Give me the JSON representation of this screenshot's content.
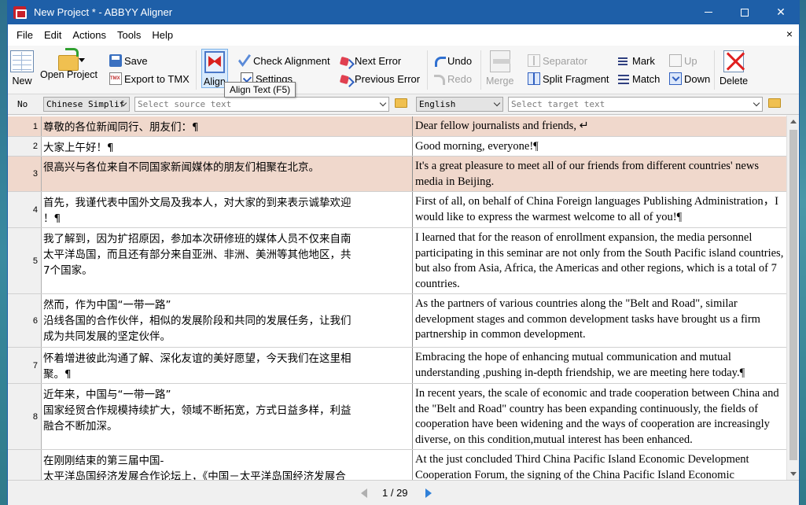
{
  "window": {
    "title": "New Project * - ABBYY Aligner",
    "close_glyph": "✕"
  },
  "menu": {
    "items": [
      "File",
      "Edit",
      "Actions",
      "Tools",
      "Help"
    ],
    "close_glyph": "×"
  },
  "toolbar": {
    "new": "New",
    "open_project": "Open Project",
    "save": "Save",
    "export_tmx": "Export to TMX",
    "align": "Align",
    "check_alignment": "Check Alignment",
    "settings": "Settings",
    "next_error": "Next Error",
    "previous_error": "Previous Error",
    "undo": "Undo",
    "redo": "Redo",
    "merge": "Merge",
    "separator": "Separator",
    "split_fragment": "Split Fragment",
    "mark": "Mark",
    "match": "Match",
    "up": "Up",
    "down": "Down",
    "delete": "Delete"
  },
  "tooltip": "Align Text (F5)",
  "langbar": {
    "no_label": "No",
    "source_language": "Chinese Simplif",
    "source_placeholder": "Select source text",
    "target_language": "English",
    "target_placeholder": "Select target text"
  },
  "rows": [
    {
      "no": "1",
      "highlight": true,
      "src": [
        "尊敬的各位新闻同行、朋友们：¶"
      ],
      "tgt": "Dear fellow journalists and friends, ↵"
    },
    {
      "no": "2",
      "highlight": false,
      "src": [
        "大家上午好！¶"
      ],
      "tgt": "Good morning, everyone!¶"
    },
    {
      "no": "3",
      "highlight": true,
      "src": [
        "很高兴与各位来自不同国家新闻媒体的朋友们相聚在北京。"
      ],
      "tgt": "It's a great pleasure to meet all of our friends from different countries' news media in Beijing."
    },
    {
      "no": "4",
      "highlight": false,
      "src": [
        "首先，我谨代表中国外文局及我本人，对大家的到来表示诚挚欢迎",
        "！¶"
      ],
      "tgt": "First of all, on behalf of China Foreign languages Publishing Administration，I would like to express the warmest welcome to all of you!¶"
    },
    {
      "no": "5",
      "highlight": false,
      "src": [
        "我了解到，因为扩招原因，参加本次研修班的媒体人员不仅来自南",
        "太平洋岛国，而且还有部分来自亚洲、非洲、美洲等其他地区，共",
        "7个国家。"
      ],
      "tgt": "I learned that for the reason of enrollment expansion, the media personnel participating in this seminar are not only from the South Pacific island countries, but also from Asia, Africa, the Americas and other regions, which is a total of 7 countries."
    },
    {
      "no": "6",
      "highlight": false,
      "src": [
        "然而，作为中国“一带一路”",
        "沿线各国的合作伙伴，相似的发展阶段和共同的发展任务，让我们",
        "成为共同发展的坚定伙伴。"
      ],
      "tgt": "As the partners of various countries along the \"Belt and Road\", similar development stages and common development tasks have brought us a firm partnership in common development."
    },
    {
      "no": "7",
      "highlight": false,
      "src": [
        "怀着增进彼此沟通了解、深化友谊的美好愿望，今天我们在这里相",
        "聚。¶"
      ],
      "tgt": "Embracing the hope of enhancing mutual communication and mutual understanding ,pushing in-depth friendship, we are meeting here today.¶"
    },
    {
      "no": "8",
      "highlight": false,
      "src": [
        "近年来，中国与“一带一路”",
        "国家经贸合作规模持续扩大，领域不断拓宽，方式日益多样，利益",
        "融合不断加深。"
      ],
      "tgt": "In recent years, the scale of economic and trade cooperation between China and the \"Belt and Road\" country has been expanding continuously, the fields of cooperation have been widening and the ways of cooperation are increasingly diverse, on this condition,mutual interest has been enhanced."
    },
    {
      "no": "",
      "highlight": false,
      "src": [
        "在刚刚结束的第三届中国-",
        "太平洋岛国经济发展合作论坛上，《中国－太平洋岛国经济发展合"
      ],
      "tgt": "At the just concluded Third China Pacific Island Economic Development Cooperation Forum, the signing of the China Pacific Island Economic"
    }
  ],
  "pager": {
    "text": "1 / 29"
  }
}
